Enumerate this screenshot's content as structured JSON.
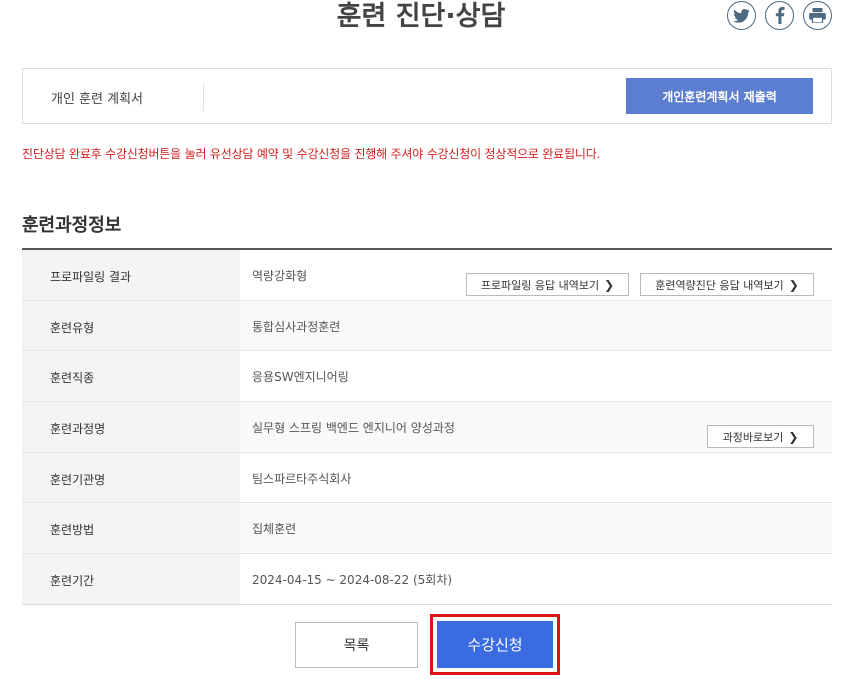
{
  "header": {
    "title": "훈련 진단·상담"
  },
  "social": [
    {
      "name": "twitter-icon"
    },
    {
      "name": "facebook-icon"
    },
    {
      "name": "print-icon"
    }
  ],
  "plan": {
    "label": "개인 훈련 계획서",
    "reprint_label": "개인훈련계획서 재출력"
  },
  "notice": "진단상담 완료후 수강신청버튼을 눌러 유선상담 예약 및 수강신청을 진행해 주셔야 수강신청이 정상적으로 완료됩니다.",
  "section": {
    "title": "훈련과정정보"
  },
  "rows": [
    {
      "label": "프로파일링 결과",
      "value": "역량강화형"
    },
    {
      "label": "훈련유형",
      "value": "통합심사과정훈련"
    },
    {
      "label": "훈련직종",
      "value": "응용SW엔지니어링"
    },
    {
      "label": "훈련과정명",
      "value": "실무형 스프링 백엔드 엔지니어 양성과정"
    },
    {
      "label": "훈련기관명",
      "value": "팀스파르타주식회사"
    },
    {
      "label": "훈련방법",
      "value": "집체훈련"
    },
    {
      "label": "훈련기간",
      "value": "2024-04-15 ~ 2024-08-22 (5회차)"
    }
  ],
  "row_buttons": {
    "profiling": "프로파일링 응답 내역보기",
    "diagnosis": "훈련역량진단 응답 내역보기",
    "course": "과정바로보기",
    "chevron": "❯"
  },
  "footer": {
    "list_label": "목록",
    "apply_label": "수강신청"
  }
}
